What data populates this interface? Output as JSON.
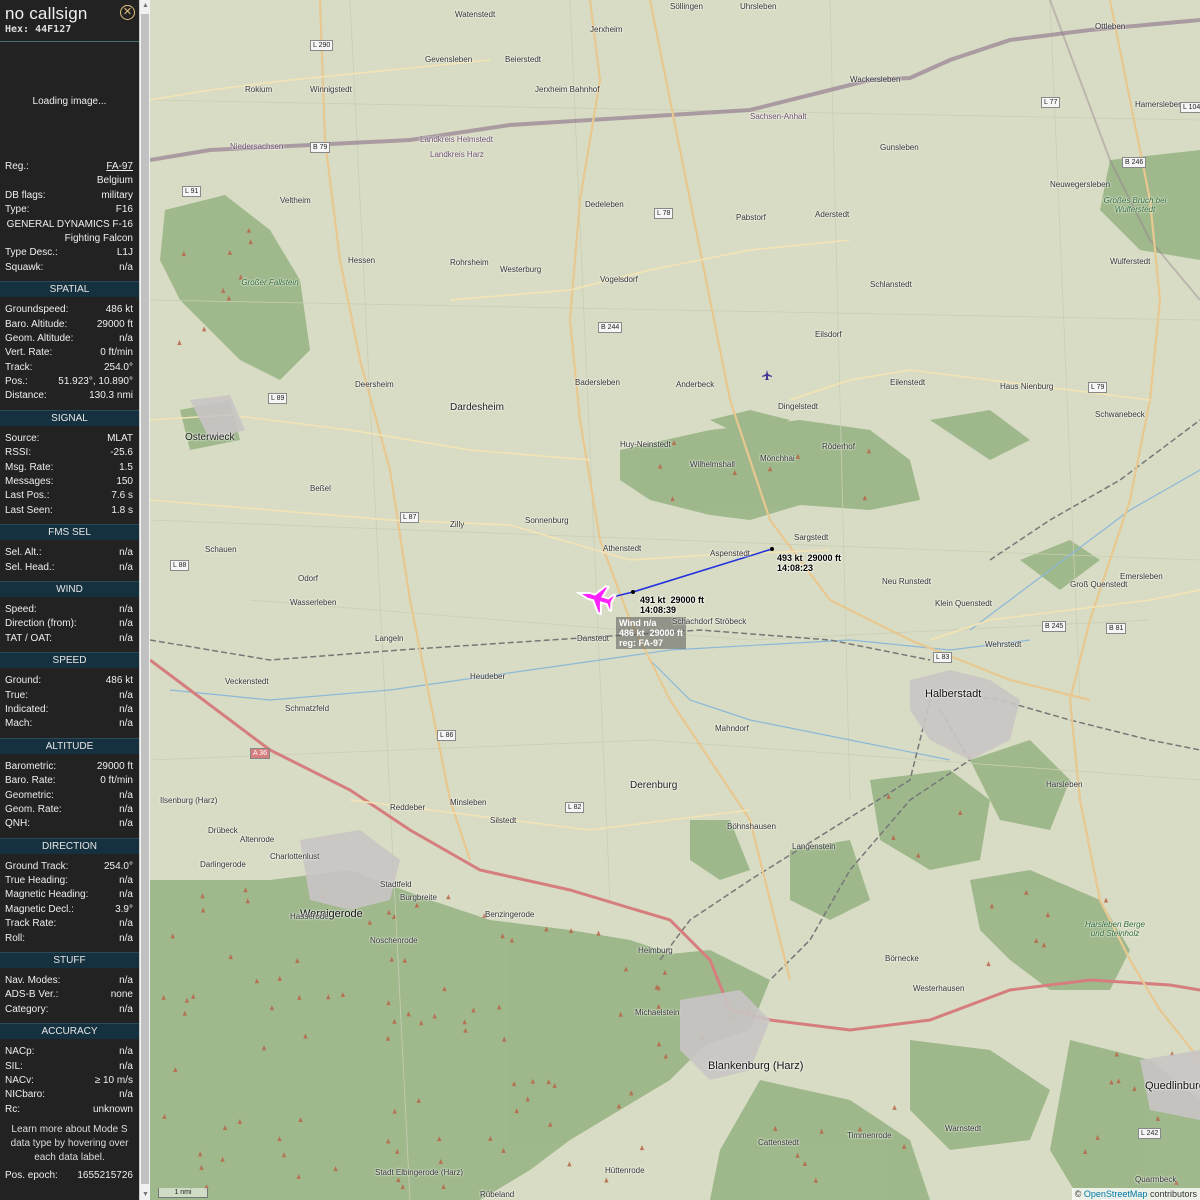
{
  "panel": {
    "callsign": "no callsign",
    "hex_label": "Hex:",
    "hex": "44F127",
    "close_glyph": "✕",
    "image_status": "Loading image...",
    "reg_label": "Reg.:",
    "reg": "FA-97",
    "country": "Belgium",
    "dbflags_label": "DB flags:",
    "dbflags": "military",
    "type_label": "Type:",
    "type": "F16",
    "type_full_1": "GENERAL DYNAMICS F-16",
    "type_full_2": "Fighting Falcon",
    "typedesc_label": "Type Desc.:",
    "typedesc": "L1J",
    "squawk_label": "Squawk:",
    "squawk": "n/a",
    "spatial": {
      "title": "SPATIAL",
      "rows": [
        {
          "k": "Groundspeed:",
          "v": "486 kt"
        },
        {
          "k": "Baro. Altitude:",
          "v": "29000 ft"
        },
        {
          "k": "Geom. Altitude:",
          "v": "n/a"
        },
        {
          "k": "Vert. Rate:",
          "v": "0 ft/min"
        },
        {
          "k": "Track:",
          "v": "254.0°"
        },
        {
          "k": "Pos.:",
          "v": "51.923°, 10.890°"
        },
        {
          "k": "Distance:",
          "v": "130.3 nmi"
        }
      ]
    },
    "signal": {
      "title": "SIGNAL",
      "rows": [
        {
          "k": "Source:",
          "v": "MLAT"
        },
        {
          "k": "RSSI:",
          "v": "-25.6"
        },
        {
          "k": "Msg. Rate:",
          "v": "1.5"
        },
        {
          "k": "Messages:",
          "v": "150"
        },
        {
          "k": "Last Pos.:",
          "v": "7.6 s"
        },
        {
          "k": "Last Seen:",
          "v": "1.8 s"
        }
      ]
    },
    "fms": {
      "title": "FMS SEL",
      "rows": [
        {
          "k": "Sel. Alt.:",
          "v": "n/a"
        },
        {
          "k": "Sel. Head.:",
          "v": "n/a"
        }
      ]
    },
    "wind": {
      "title": "WIND",
      "rows": [
        {
          "k": "Speed:",
          "v": "n/a"
        },
        {
          "k": "Direction (from):",
          "v": "n/a"
        },
        {
          "k": "TAT / OAT:",
          "v": "n/a"
        }
      ]
    },
    "speed": {
      "title": "SPEED",
      "rows": [
        {
          "k": "Ground:",
          "v": "486 kt"
        },
        {
          "k": "True:",
          "v": "n/a"
        },
        {
          "k": "Indicated:",
          "v": "n/a"
        },
        {
          "k": "Mach:",
          "v": "n/a"
        }
      ]
    },
    "altitude": {
      "title": "ALTITUDE",
      "rows": [
        {
          "k": "Barometric:",
          "v": "29000 ft"
        },
        {
          "k": "Baro. Rate:",
          "v": "0 ft/min"
        },
        {
          "k": "Geometric:",
          "v": "n/a"
        },
        {
          "k": "Geom. Rate:",
          "v": "n/a"
        },
        {
          "k": "QNH:",
          "v": "n/a"
        }
      ]
    },
    "direction": {
      "title": "DIRECTION",
      "rows": [
        {
          "k": "Ground Track:",
          "v": "254.0°"
        },
        {
          "k": "True Heading:",
          "v": "n/a"
        },
        {
          "k": "Magnetic Heading:",
          "v": "n/a"
        },
        {
          "k": "Magnetic Decl.:",
          "v": "3.9°"
        },
        {
          "k": "Track Rate:",
          "v": "n/a"
        },
        {
          "k": "Roll:",
          "v": "n/a"
        }
      ]
    },
    "stuff": {
      "title": "STUFF",
      "rows": [
        {
          "k": "Nav. Modes:",
          "v": "n/a"
        },
        {
          "k": "ADS-B Ver.:",
          "v": "none"
        },
        {
          "k": "Category:",
          "v": "n/a"
        }
      ]
    },
    "accuracy": {
      "title": "ACCURACY",
      "rows": [
        {
          "k": "NACp:",
          "v": "n/a"
        },
        {
          "k": "SIL:",
          "v": "n/a"
        },
        {
          "k": "NACv:",
          "v": "≥ 10 m/s"
        },
        {
          "k": "NICbaro:",
          "v": "n/a"
        },
        {
          "k": "Rc:",
          "v": "unknown"
        }
      ]
    },
    "note": "Learn more about Mode S data type by hovering over each data label.",
    "epoch_label": "Pos. epoch:",
    "epoch": "1655215726"
  },
  "map": {
    "attribution_prefix": "©",
    "attribution_link": "OpenStreetMap",
    "attribution_suffix": "contributors",
    "scale_label": "1 nmi",
    "colors": {
      "trail": "#2233dd",
      "aircraft": "#ff22ff",
      "forest": "#8fb07a"
    },
    "aircraft_icon": "fighter-jet-icon",
    "labels": {
      "start": {
        "line1": "493 kt  29000 ft",
        "line2": "14:08:23"
      },
      "mid": {
        "line1": "491 kt  29000 ft",
        "line2": "14:08:39"
      },
      "tooltip": {
        "line1": "Wind n/a",
        "line2": "486 kt  29000 ft",
        "line3": "reg: FA-97"
      }
    },
    "places": [
      "Watenstedt",
      "Jerxheim",
      "Söllingen",
      "Uhrsleben",
      "Ottleben",
      "Beierstedt",
      "Gevensleben",
      "Jerxheim Bahnhof",
      "Wackersleben",
      "Hamersleben",
      "Rohrsheim",
      "Westerburg",
      "Hessen",
      "Vogelsdorf",
      "Dedeleben",
      "Pabstorf",
      "Aderstedt",
      "Badersleben",
      "Anderbeck",
      "Dardesheim",
      "Deersheim",
      "Osterwieck",
      "Huy-Neinstedt",
      "Dingelstedt",
      "Eilenstedt",
      "Haus Nienburg",
      "Schwanebeck",
      "Röderhof",
      "Mönchhai",
      "Wilhelmshall",
      "Sargstedt",
      "Sonnenburg",
      "Zilly",
      "Athenstedt",
      "Aspenstedt",
      "Schauen",
      "Odorf",
      "Wasserleben",
      "Langeln",
      "Danstedt",
      "Schachdorf Ströbeck",
      "Neu Runstedt",
      "Groß Quenstedt",
      "Emersleben",
      "Klein Quenstedt",
      "Halberstadt",
      "Wehrstedt",
      "Heudeber",
      "Veckenstedt",
      "Schmatzfeld",
      "Mahndorf",
      "Derenburg",
      "Harsleben",
      "Reddeber",
      "Minsleben",
      "Silstedt",
      "Böhnshausen",
      "Langenstein",
      "Drübeck",
      "Altenrode",
      "Darlingerode",
      "Charlottenlust",
      "Stadtfeld",
      "Wernigerode",
      "Burgbreite",
      "Hasserode",
      "Noschenrode",
      "Benzingerode",
      "Heimburg",
      "Börnecke",
      "Westerhausen",
      "Michaelstein",
      "Blankenburg (Harz)",
      "Quedlinburg",
      "Cattenstedt",
      "Timmenrode",
      "Warnstedt",
      "Stadt Elbingerode (Harz)",
      "Hüttenrode",
      "Rübeland",
      "Quarmbeck",
      "Gunsleben",
      "Neuwegersleben",
      "Wulferstedt",
      "Schlanstedt",
      "Eilsdorf",
      "Rokium",
      "Winnigstedt",
      "Veltheim",
      "Beßel",
      "Ilsenburg (Harz)"
    ],
    "areas": [
      "Großer Fallstein",
      "Großes Bruch bei Wulferstedt",
      "Harsleben Berge und Steinholz"
    ],
    "roads": [
      "L 290",
      "L 91",
      "L 78",
      "B 79",
      "B 244",
      "L 89",
      "L 87",
      "L 88",
      "L 86",
      "A 36",
      "L 82",
      "L 83",
      "B 245",
      "B 81",
      "B 246",
      "L 77",
      "L 104",
      "L 79",
      "L 242",
      "L 240"
    ],
    "admin": [
      "Niedersachsen",
      "Landkreis Harz",
      "Landkreis Helmstedt",
      "Sachsen-Anhalt"
    ]
  }
}
